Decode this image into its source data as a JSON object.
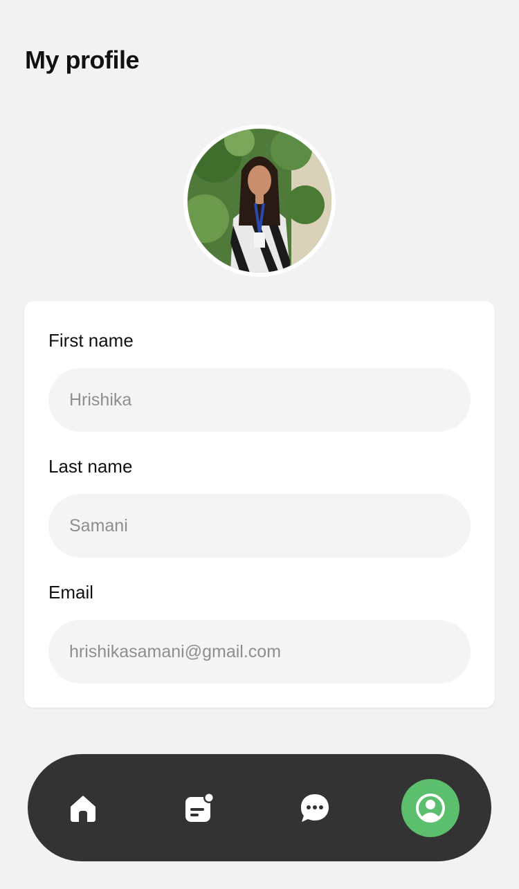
{
  "header": {
    "title": "My profile"
  },
  "profile": {
    "fields": [
      {
        "label": "First name",
        "value": "Hrishika"
      },
      {
        "label": "Last name",
        "value": "Samani"
      },
      {
        "label": "Email",
        "value": "hrishikasamani@gmail.com"
      }
    ]
  },
  "nav": {
    "items": [
      {
        "icon": "home-icon",
        "active": false
      },
      {
        "icon": "notes-icon",
        "active": false
      },
      {
        "icon": "chat-icon",
        "active": false
      },
      {
        "icon": "profile-icon",
        "active": true
      }
    ],
    "active_color": "#5bbf6e"
  }
}
